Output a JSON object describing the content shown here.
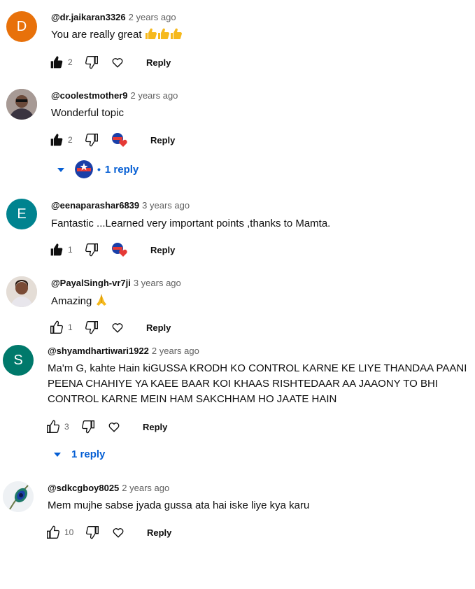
{
  "comments": [
    {
      "handle": "@dr.jaikaran3326",
      "time": "2 years ago",
      "text": "You are really great",
      "avatar_letter": "D",
      "avatar_color": "#e8710a",
      "likes": "2",
      "liked": true,
      "creator_heart": false,
      "reply_label": "Reply",
      "trailing_emoji": "thumbs-up x3"
    },
    {
      "handle": "@coolestmother9",
      "time": "2 years ago",
      "text": "Wonderful topic",
      "avatar_letter": "",
      "likes": "2",
      "liked": true,
      "creator_heart": true,
      "reply_label": "Reply",
      "replies_label": "1 reply"
    },
    {
      "handle": "@eenaparashar6839",
      "time": "3 years ago",
      "text": "Fantastic ...Learned very important points ,thanks to Mamta.",
      "avatar_letter": "E",
      "avatar_color": "#00838f",
      "likes": "1",
      "liked": true,
      "creator_heart": true,
      "reply_label": "Reply"
    },
    {
      "handle": "@PayalSingh-vr7ji",
      "time": "3 years ago",
      "text": "Amazing",
      "avatar_letter": "",
      "likes": "1",
      "liked": false,
      "creator_heart": false,
      "reply_label": "Reply",
      "trailing_emoji": "folded-hands"
    },
    {
      "handle": "@shyamdhartiwari1922",
      "time": "2 years ago",
      "text_lines": [
        "Ma'm G, kahte Hain kiGUSSA KRODH KO CONTROL KARNE KE LIYE  THANDAA PAANI",
        "PEENA CHAHIYE  YA KAEE BAAR KOI KHAAS RISHTEDAAR AA JAAONY TO BHI",
        "CONTROL KARNE MEIN HAM SAKCHHAM HO JAATE HAIN"
      ],
      "avatar_letter": "S",
      "avatar_color": "#00796b",
      "likes": "3",
      "liked": false,
      "creator_heart": false,
      "reply_label": "Reply",
      "replies_label": "1 reply"
    },
    {
      "handle": "@sdkcgboy8025",
      "time": "2 years ago",
      "text": "Mem mujhe sabse jyada gussa ata hai iske liye kya karu",
      "avatar_letter": "",
      "likes": "10",
      "liked": false,
      "creator_heart": false,
      "reply_label": "Reply"
    }
  ],
  "colors": {
    "link_blue": "#065fd4",
    "secondary_text": "#606060",
    "heart_red": "#e53935"
  }
}
